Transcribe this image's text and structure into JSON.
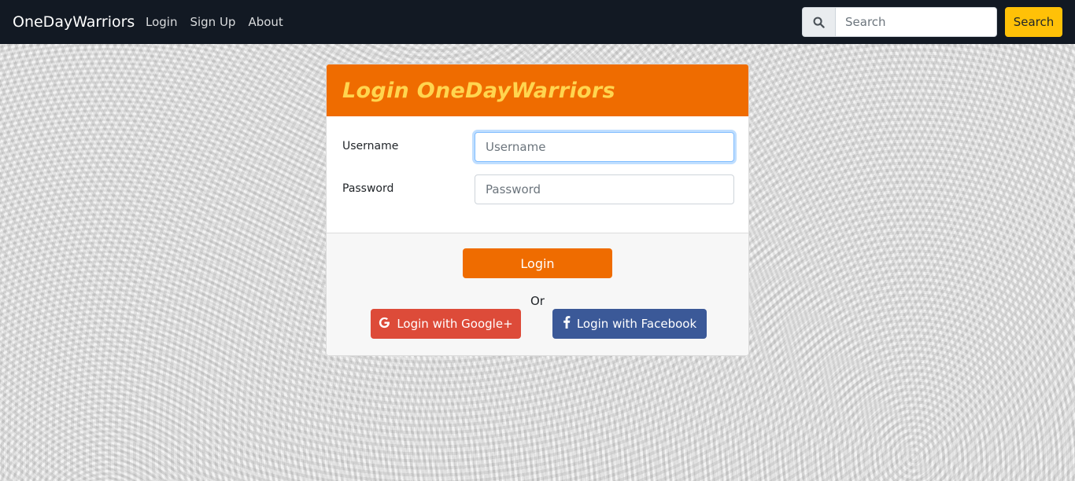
{
  "navbar": {
    "brand": "OneDayWarriors",
    "links": [
      "Login",
      "Sign Up",
      "About"
    ],
    "search": {
      "placeholder": "Search",
      "button_label": "Search",
      "icon": "search-icon"
    }
  },
  "login_card": {
    "title": "Login OneDayWarriors",
    "username": {
      "label": "Username",
      "placeholder": "Username"
    },
    "password": {
      "label": "Password",
      "placeholder": "Password"
    },
    "login_button": "Login",
    "or_text": "Or",
    "google_button": {
      "label": "Login with Google+",
      "icon": "google-icon"
    },
    "facebook_button": {
      "label": "Login with Facebook",
      "icon": "facebook-icon"
    }
  },
  "colors": {
    "navbar_bg": "#121923",
    "card_header": "#ef6c00",
    "card_title": "#ffd54f",
    "search_button": "#ffc107",
    "google": "#dd4b39",
    "facebook": "#3b5998"
  }
}
